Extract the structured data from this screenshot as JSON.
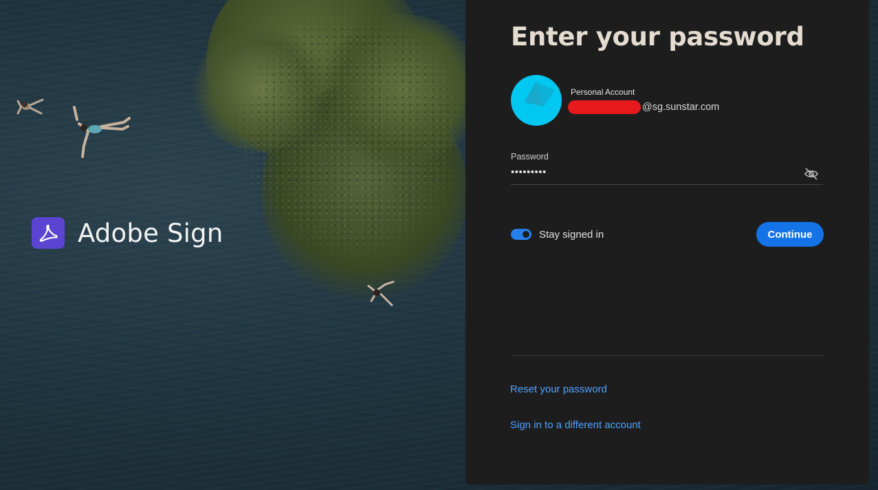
{
  "brand": {
    "name": "Adobe Sign",
    "logo_icon": "adobe-acrobat-icon",
    "logo_color": "#5c44d3"
  },
  "panel": {
    "title": "Enter your password",
    "account": {
      "type": "Personal Account",
      "email_suffix": "@sg.sunstar.com",
      "avatar_color": "#00c8f0",
      "redaction_color": "#e8191c"
    },
    "password": {
      "label": "Password",
      "masked_value": "•••••••••",
      "toggle_icon": "eye-slash-icon"
    },
    "stay_signed_in": {
      "label": "Stay signed in",
      "checked": true
    },
    "continue_label": "Continue",
    "links": {
      "reset": "Reset your password",
      "switch_account": "Sign in to a different account"
    },
    "colors": {
      "accent": "#1473e6",
      "link": "#4ea3ff",
      "background": "#1d1d1e"
    }
  }
}
